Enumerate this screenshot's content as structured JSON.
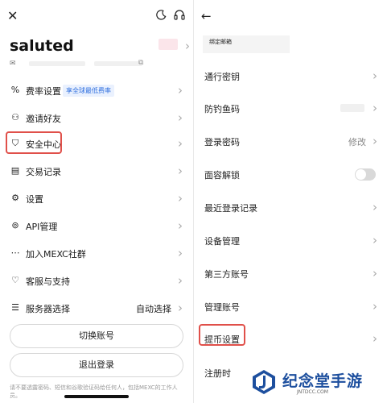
{
  "left": {
    "close_icon": "✕",
    "username": "saluted",
    "mail_icon": "✉",
    "menu": [
      {
        "icon": "%",
        "label": "费率设置",
        "badge": "享全球最低费率"
      },
      {
        "icon": "⚇",
        "label": "邀请好友"
      },
      {
        "icon": "⛉",
        "label": "安全中心"
      },
      {
        "icon": "▤",
        "label": "交易记录"
      },
      {
        "icon": "⚙",
        "label": "设置"
      },
      {
        "icon": "⊚",
        "label": "API管理"
      },
      {
        "icon": "⋯",
        "label": "加入MEXC社群"
      },
      {
        "icon": "♡",
        "label": "客服与支持"
      },
      {
        "icon": "☰",
        "label": "服务器选择",
        "value": "自动选择"
      }
    ],
    "switch_account_label": "切换账号",
    "logout_label": "退出登录",
    "footnote": "请不要透露密码、短信和谷歌验证码给任何人，包括MEXC的工作人员。"
  },
  "right": {
    "back_icon": "←",
    "bind_email_label": "绑定邮箱",
    "rows": [
      {
        "label": "通行密钥"
      },
      {
        "label": "防钓鱼码"
      },
      {
        "label": "登录密码",
        "value": "修改"
      },
      {
        "label": "面容解锁"
      },
      {
        "label": "最近登录记录"
      },
      {
        "label": "设备管理"
      },
      {
        "label": "第三方账号"
      },
      {
        "label": "管理账号"
      },
      {
        "label": "提币设置"
      },
      {
        "label": "注册时"
      }
    ],
    "face_unlock_on": false
  },
  "watermark": {
    "text": "纪念堂手游",
    "sub": "JNTDCC.COM"
  },
  "colors": {
    "highlight": "#e0504a",
    "badge_blue": "#2f6fdf",
    "watermark_blue": "#1d4f9e"
  }
}
